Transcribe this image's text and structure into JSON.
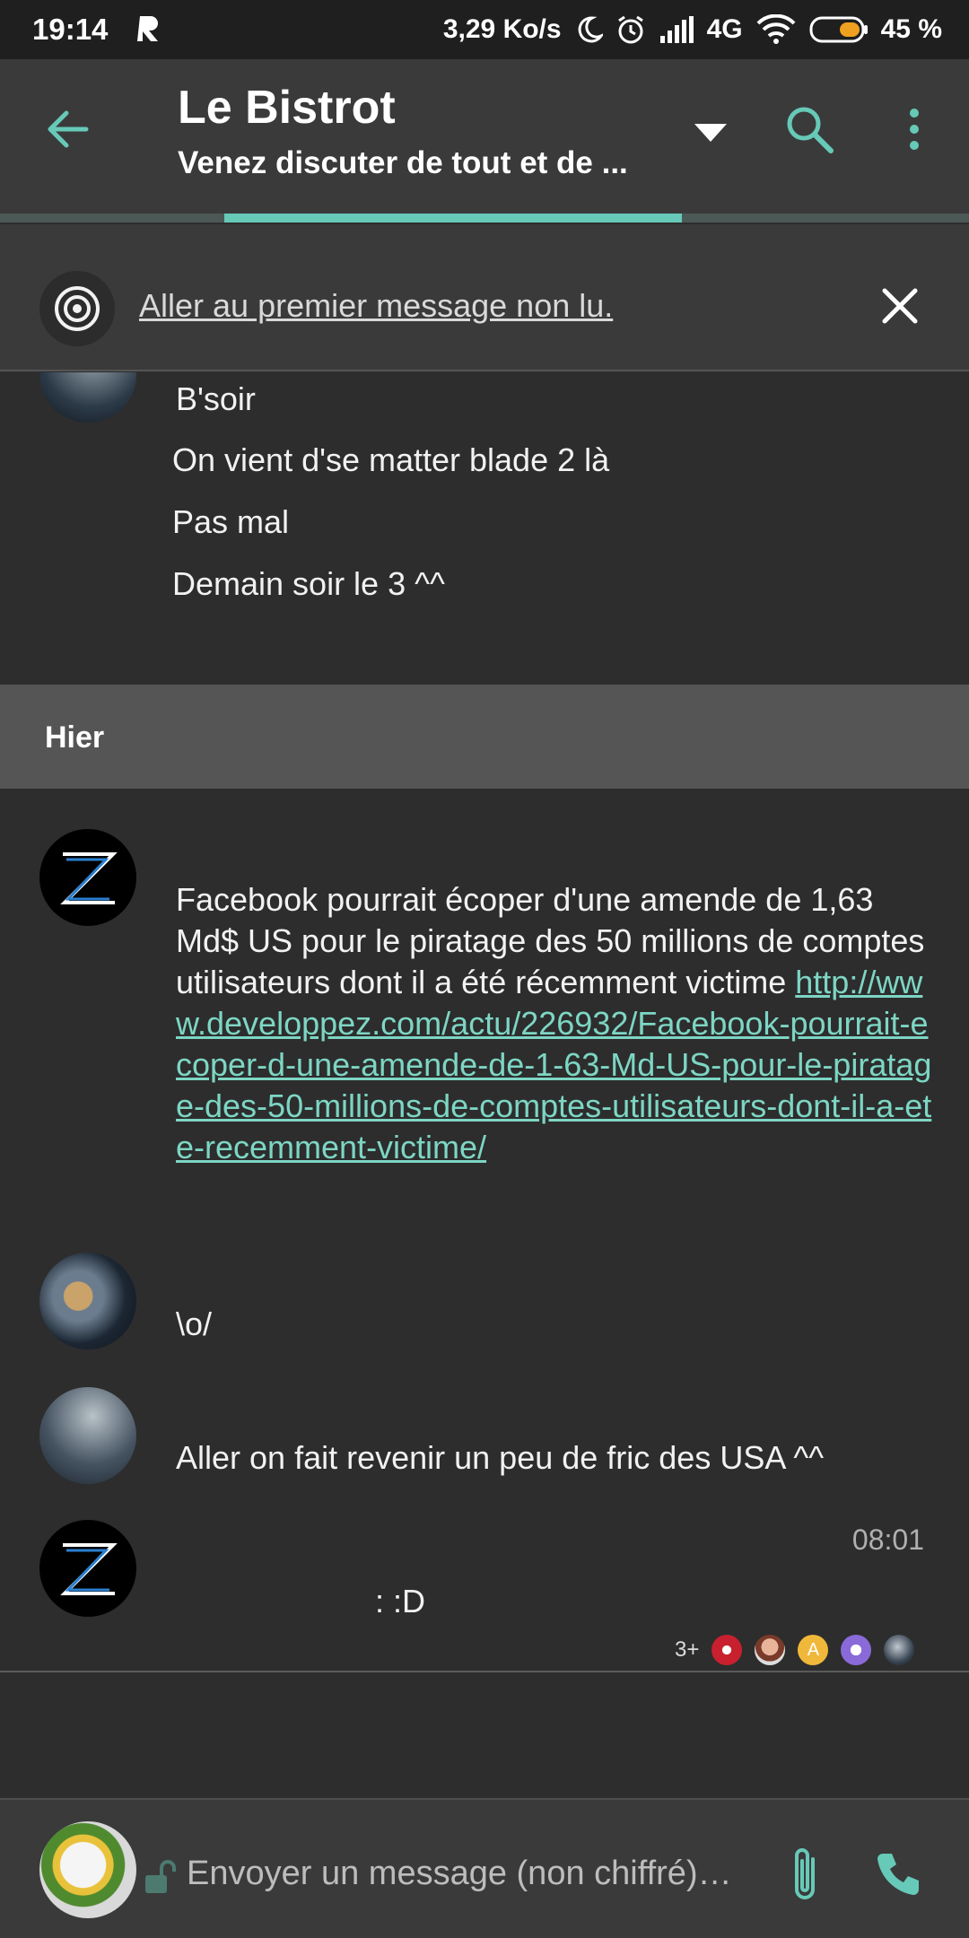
{
  "status_bar": {
    "time": "19:14",
    "net_speed": "3,29 Ko/s",
    "network": "4G",
    "battery": "45 %"
  },
  "header": {
    "title": "Le Bistrot",
    "subtitle": "Venez discuter de tout et de ..."
  },
  "banner": {
    "text": "Aller au premier message non lu."
  },
  "messages_top": [
    "B'soir",
    "On vient d'se matter blade 2 là",
    "Pas mal",
    "Demain soir le 3 ^^"
  ],
  "day_separator": "Hier",
  "message_long": {
    "text": "Facebook pourrait écoper d'une amende de 1,63 Md$ US pour le piratage des 50 millions de comptes utilisateurs dont il a été récemment victime ",
    "link": "http://www.developpez.com/actu/226932/Facebook-pourrait-ecoper-d-une-amende-de-1-63-Md-US-pour-le-piratage-des-50-millions-de-comptes-utilisateurs-dont-il-a-ete-recemment-victime/"
  },
  "message_2": "\\o/",
  "message_3": "Aller on fait revenir un peu de fric des USA ^^",
  "message_4": {
    "time": "08:01",
    "text": ": :D"
  },
  "read_receipts": {
    "count": "3+",
    "avatars": [
      "avatar-red",
      "avatar-face",
      "avatar-letter-a",
      "avatar-purple",
      "avatar-dark"
    ],
    "letter": "A"
  },
  "composer": {
    "placeholder": "Envoyer un message (non chiffré)…"
  },
  "colors": {
    "accent": "#67c9b8",
    "link": "#7dd6c4",
    "background": "#2d2d2d",
    "bar": "#3a3a3a"
  }
}
